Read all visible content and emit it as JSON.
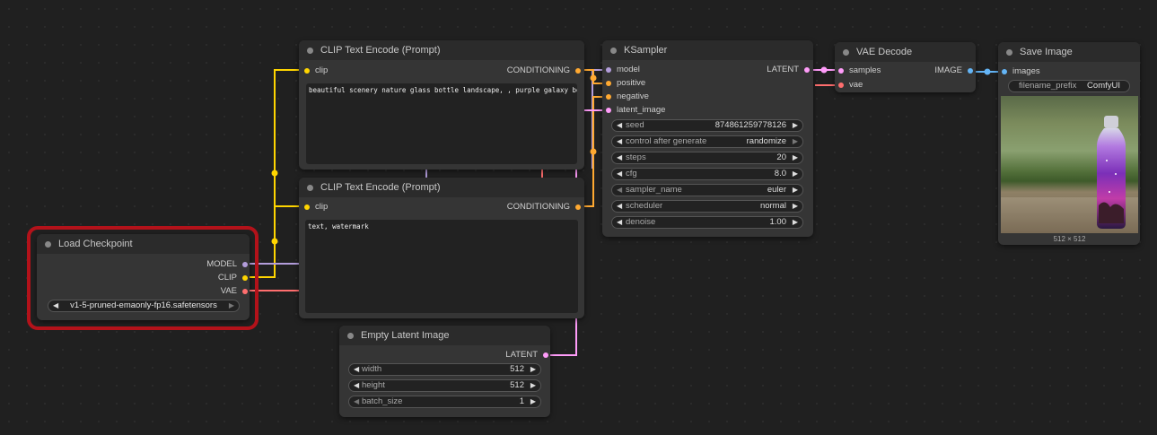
{
  "nodes": {
    "clip_pos": {
      "title": "CLIP Text Encode (Prompt)",
      "input": "clip",
      "output": "CONDITIONING",
      "text": "beautiful scenery nature glass bottle landscape, , purple galaxy bottle,"
    },
    "clip_neg": {
      "title": "CLIP Text Encode (Prompt)",
      "input": "clip",
      "output": "CONDITIONING",
      "text": "text, watermark"
    },
    "load_ckpt": {
      "title": "Load Checkpoint",
      "outputs": [
        "MODEL",
        "CLIP",
        "VAE"
      ],
      "ckpt_name": "v1-5-pruned-emaonly-fp16.safetensors"
    },
    "ksampler": {
      "title": "KSampler",
      "inputs": [
        "model",
        "positive",
        "negative",
        "latent_image"
      ],
      "output": "LATENT",
      "widgets": [
        {
          "name": "seed",
          "value": "874861259778126"
        },
        {
          "name": "control after generate",
          "value": "randomize"
        },
        {
          "name": "steps",
          "value": "20"
        },
        {
          "name": "cfg",
          "value": "8.0"
        },
        {
          "name": "sampler_name",
          "value": "euler"
        },
        {
          "name": "scheduler",
          "value": "normal"
        },
        {
          "name": "denoise",
          "value": "1.00"
        }
      ]
    },
    "vae_decode": {
      "title": "VAE Decode",
      "inputs": [
        "samples",
        "vae"
      ],
      "output": "IMAGE"
    },
    "save_image": {
      "title": "Save Image",
      "input": "images",
      "filename_prefix_label": "filename_prefix",
      "filename_prefix": "ComfyUI",
      "image_size": "512 × 512"
    },
    "empty_latent": {
      "title": "Empty Latent Image",
      "output": "LATENT",
      "widgets": [
        {
          "name": "width",
          "value": "512"
        },
        {
          "name": "height",
          "value": "512"
        },
        {
          "name": "batch_size",
          "value": "1"
        }
      ]
    }
  },
  "colors": {
    "clip": "#ffd500",
    "conditioning": "#ffa931",
    "model": "#b39ddb",
    "vae": "#ff6e6e",
    "latent": "#ff9cf9",
    "image": "#64b5f6",
    "highlight": "#b3121a"
  }
}
